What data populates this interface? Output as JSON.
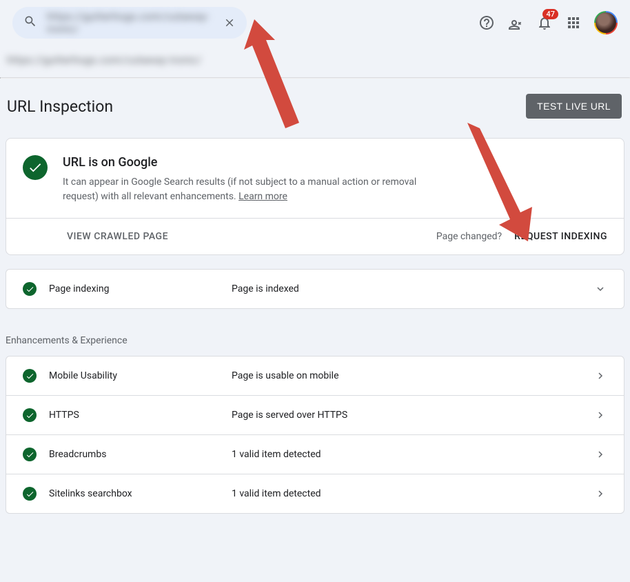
{
  "header": {
    "search_value": "https://gutterhogs.com/cutaway-ironic/",
    "notifications_count": "47"
  },
  "breadcrumb_text": "https://gutterhogs.com/cutaway-ironic/",
  "page": {
    "title": "URL Inspection",
    "test_live_url_label": "TEST LIVE URL"
  },
  "status": {
    "heading": "URL is on Google",
    "description_pre": "It can appear in Google Search results (if not subject to a manual action or removal request) with all relevant enhancements. ",
    "learn_more_label": "Learn more"
  },
  "actions": {
    "view_crawled_label": "VIEW CRAWLED PAGE",
    "page_changed_label": "Page changed?",
    "request_indexing_label": "REQUEST INDEXING"
  },
  "indexing_row": {
    "label": "Page indexing",
    "value": "Page is indexed"
  },
  "enhancements_heading": "Enhancements & Experience",
  "enhancements": [
    {
      "label": "Mobile Usability",
      "value": "Page is usable on mobile"
    },
    {
      "label": "HTTPS",
      "value": "Page is served over HTTPS"
    },
    {
      "label": "Breadcrumbs",
      "value": "1 valid item detected"
    },
    {
      "label": "Sitelinks searchbox",
      "value": "1 valid item detected"
    }
  ]
}
